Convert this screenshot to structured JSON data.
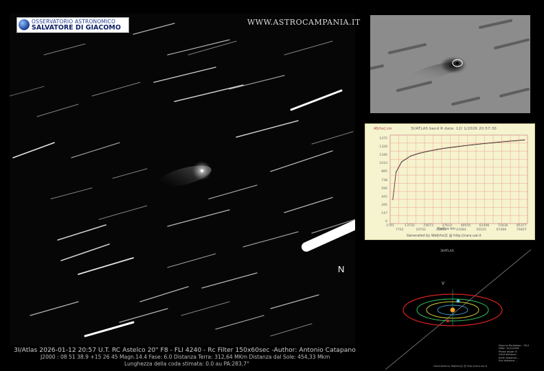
{
  "logo": {
    "line1": "OSSERVATORIO ASTRONOMICO",
    "line2": "SALVATORE DI GIACOMO"
  },
  "site_url": "WWW.ASTROCAMPANIA.IT",
  "north_marker": "N",
  "caption": {
    "line1": "3I/Atlas 2026-01-12  20:57 U.T.  RC Astelco 20\" F8 - FLI 4240 - Rc Filter 150x60sec -Author: Antonio Catapano",
    "line2": "J2000 : 08 51 38.9 +15 26 45  Magn.14.4  Fase: 6.0  Distanza Terra: 312,64 MKm  Distanza dal Sole: 454,33 Mkm",
    "line3": "Lunghezza della coda stimata: 0.0 au   PA:283,7°"
  },
  "profile": {
    "ylabel": "Af[rho] cm",
    "title": "3I/ATLAS band R  date: 12/ 1/2026 20:57:30",
    "xlabel": "Radius km",
    "footer": "Generated by Wafjrho]1 @ http://cara.uai.it",
    "chart_data": {
      "type": "line",
      "y_ticks": [
        "1475",
        "1328",
        "1180",
        "1033",
        "885",
        "738",
        "590",
        "442",
        "295",
        "147",
        "0"
      ],
      "x_ticks_top": [
        "1791",
        "13732",
        "25673",
        "37614",
        "49555",
        "61496",
        "73436",
        "85377"
      ],
      "x_ticks_bottom": [
        "7762",
        "19702",
        "31643",
        "43584",
        "55525",
        "67466",
        "79407"
      ],
      "x": [
        1791,
        4000,
        7762,
        13732,
        19702,
        25673,
        31643,
        37614,
        43584,
        49555,
        55525,
        61496,
        67466,
        73436,
        79407,
        85377,
        91000
      ],
      "y": [
        420,
        900,
        1080,
        1180,
        1230,
        1265,
        1295,
        1320,
        1340,
        1360,
        1378,
        1395,
        1410,
        1425,
        1438,
        1452,
        1465
      ],
      "xlim": [
        0,
        93000
      ],
      "ylim": [
        0,
        1550
      ]
    }
  },
  "orbit": {
    "title": "3I/ATLAS",
    "info": [
      "Days to Perihelion: -76.0",
      "Date: 12/1/2026",
      "Phase angle: 6",
      "Orbit distance...",
      "Earth distance...",
      "Sun distance..."
    ],
    "credit": "Generated by Wafjrho]1 @ http://cara.uai.it"
  }
}
